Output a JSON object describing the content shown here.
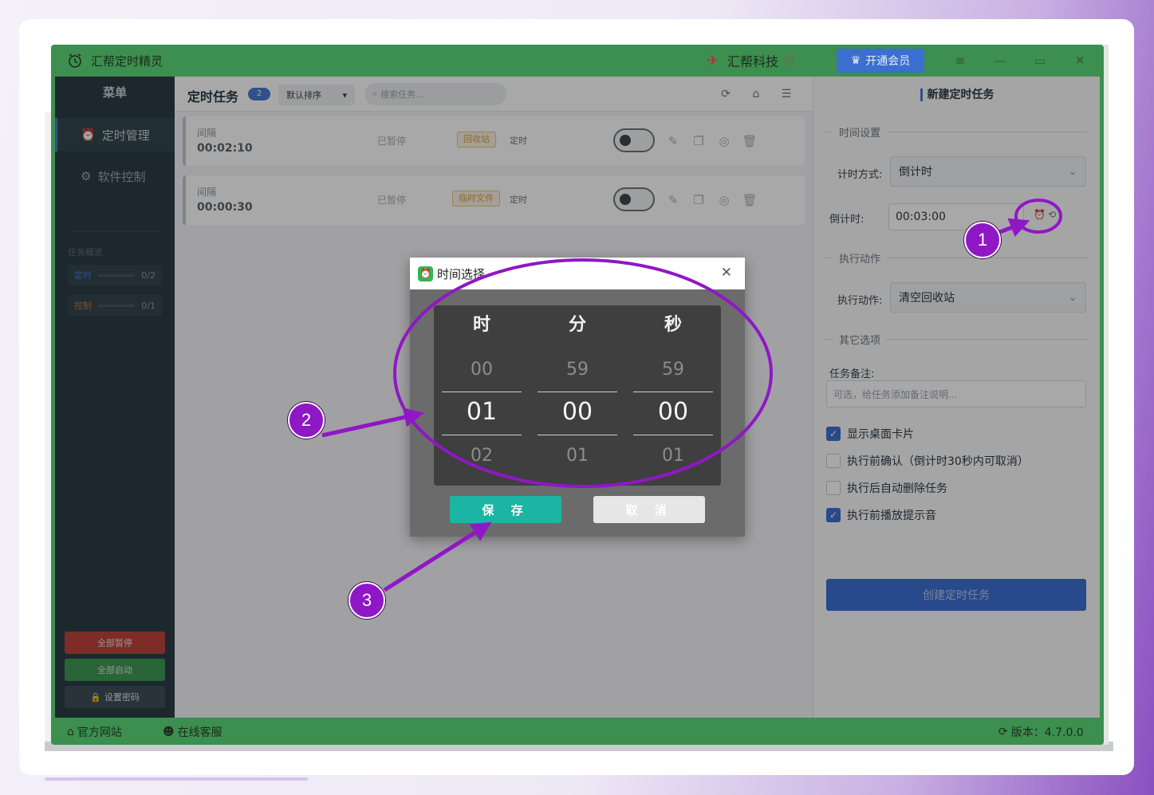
{
  "app": {
    "title": "汇帮定时精灵",
    "brand": "汇帮科技",
    "vip_button": "开通会员"
  },
  "sidebar": {
    "title": "菜单",
    "items": [
      {
        "label": "定时管理",
        "active": true
      },
      {
        "label": "软件控制",
        "active": false
      }
    ],
    "overview": {
      "title": "任务概览",
      "rows": [
        {
          "label": "定时",
          "value": "0/2"
        },
        {
          "label": "控制",
          "value": "0/1"
        }
      ]
    },
    "buttons": {
      "pause_all": "全部暂停",
      "start_all": "全部启动",
      "set_password": "设置密码"
    }
  },
  "task_list": {
    "title": "定时任务",
    "count": "2",
    "sort": "默认排序",
    "search_placeholder": "搜索任务...",
    "tasks": [
      {
        "label": "间隔",
        "time": "00:02:10",
        "status": "已暂停",
        "tag": "回收站",
        "type": "定时"
      },
      {
        "label": "间隔",
        "time": "00:00:30",
        "status": "已暂停",
        "tag": "临时文件",
        "type": "定时"
      }
    ]
  },
  "new_task": {
    "title": "新建定时任务",
    "time_section": "时间设置",
    "mode_label": "计时方式:",
    "mode_value": "倒计时",
    "countdown_label": "倒计时:",
    "countdown_value": "00:03:00",
    "action_section": "执行动作",
    "action_label": "执行动作:",
    "action_value": "清空回收站",
    "other_section": "其它选项",
    "note_label": "任务备注:",
    "note_placeholder": "可选，给任务添加备注说明...",
    "options": [
      {
        "label": "显示桌面卡片",
        "checked": true
      },
      {
        "label": "执行前确认（倒计时30秒内可取消）",
        "checked": false
      },
      {
        "label": "执行后自动删除任务",
        "checked": false
      },
      {
        "label": "执行前播放提示音",
        "checked": true
      }
    ],
    "create_button": "创建定时任务"
  },
  "statusbar": {
    "website": "官方网站",
    "support": "在线客服",
    "version": "版本：4.7.0.0"
  },
  "dialog": {
    "title": "时间选择",
    "columns": [
      {
        "head": "时",
        "prev": "00",
        "value": "01",
        "next": "02"
      },
      {
        "head": "分",
        "prev": "59",
        "value": "00",
        "next": "01"
      },
      {
        "head": "秒",
        "prev": "59",
        "value": "00",
        "next": "01"
      }
    ],
    "save": "保 存",
    "cancel": "取 消"
  },
  "annotations": [
    "1",
    "2",
    "3"
  ],
  "colors": {
    "accent": "#8f17c6",
    "titlebar": "#3c8f4f",
    "primary": "#3d6fd4",
    "save": "#1cb5a3"
  }
}
